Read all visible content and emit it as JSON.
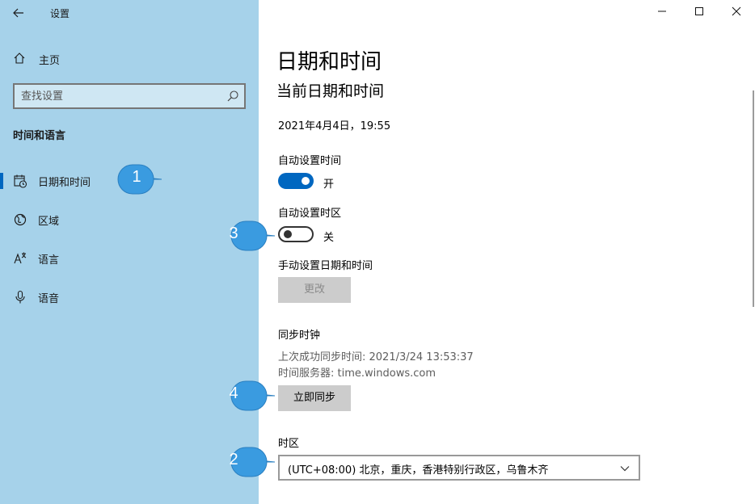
{
  "window": {
    "app_title": "设置",
    "back_glyph": "←",
    "minimize_glyph": "—",
    "maximize_glyph": "☐",
    "close_glyph": "✕"
  },
  "sidebar": {
    "home_label": "主页",
    "search_placeholder": "查找设置",
    "section_title": "时间和语言",
    "items": [
      {
        "label": "日期和时间",
        "icon": "calendar-clock-icon",
        "active": true
      },
      {
        "label": "区域",
        "icon": "globe-icon",
        "active": false
      },
      {
        "label": "语言",
        "icon": "language-icon",
        "active": false
      },
      {
        "label": "语音",
        "icon": "microphone-icon",
        "active": false
      }
    ]
  },
  "main": {
    "page_title": "日期和时间",
    "subtitle": "当前日期和时间",
    "current_datetime": "2021年4月4日，19:55",
    "auto_time": {
      "label": "自动设置时间",
      "state": "开",
      "on": true
    },
    "auto_timezone": {
      "label": "自动设置时区",
      "state": "关",
      "on": false
    },
    "manual": {
      "label": "手动设置日期和时间",
      "button": "更改"
    },
    "sync": {
      "title": "同步时钟",
      "last_sync": "上次成功同步时间: 2021/3/24 13:53:37",
      "server": "时间服务器: time.windows.com",
      "button": "立即同步"
    },
    "timezone": {
      "label": "时区",
      "value": "(UTC+08:00) 北京，重庆，香港特别行政区，乌鲁木齐"
    }
  },
  "callouts": [
    "1",
    "2",
    "3",
    "4"
  ],
  "colors": {
    "sidebar_bg": "#a6d2ea",
    "accent": "#0067c0",
    "callout": "#3a9be0"
  }
}
